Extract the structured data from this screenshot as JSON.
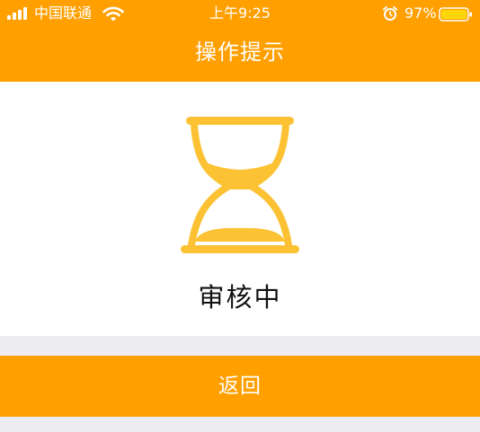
{
  "status_bar": {
    "carrier": "中国联通",
    "time": "上午9:25",
    "battery_percent": "97%",
    "icons": [
      "signal-icon",
      "wifi-icon",
      "alarm-icon",
      "battery-icon"
    ]
  },
  "header": {
    "title": "操作提示"
  },
  "main": {
    "icon": "hourglass-icon",
    "status": "审核中"
  },
  "actions": {
    "back_label": "返回"
  },
  "colors": {
    "accent": "#ff9f00",
    "hourglass": "#fcc233",
    "background": "#ececf1",
    "card": "#ffffff"
  }
}
